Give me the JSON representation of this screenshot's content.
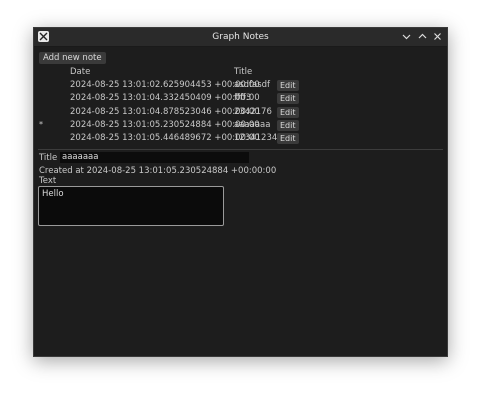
{
  "window": {
    "title": "Graph Notes",
    "app_icon": "x-logo-icon",
    "controls": [
      "chevron-down-icon",
      "chevron-up-icon",
      "close-icon"
    ]
  },
  "toolbar": {
    "add_label": "Add new note"
  },
  "table": {
    "headers": {
      "date": "Date",
      "title": "Title"
    },
    "edit_label": "Edit",
    "selected_marker": "*",
    "rows": [
      {
        "date": "2024-08-25 13:01:02.625904453 +00:00:00",
        "title": "asdfasdf",
        "selected": false
      },
      {
        "date": "2024-08-25 13:01:04.332450409 +00:00:00",
        "title": "ffff3",
        "selected": false
      },
      {
        "date": "2024-08-25 13:01:04.878523046 +00:00:00",
        "title": "2342176",
        "selected": false
      },
      {
        "date": "2024-08-25 13:01:05.230524884 +00:00:00",
        "title": "aaaaaaa",
        "selected": true
      },
      {
        "date": "2024-08-25 13:01:05.446489672 +00:00:00",
        "title": "12341234",
        "selected": false
      }
    ]
  },
  "detail": {
    "title_label": "Title",
    "title_value": "aaaaaaa",
    "created_text": "Created at 2024-08-25 13:01:05.230524884 +00:00:00",
    "text_label": "Text",
    "text_value": "Hello"
  },
  "colors": {
    "background": "#1d1d1d",
    "button": "#3a3a3a",
    "input": "#0c0c0c",
    "text": "#c9c9c9"
  }
}
